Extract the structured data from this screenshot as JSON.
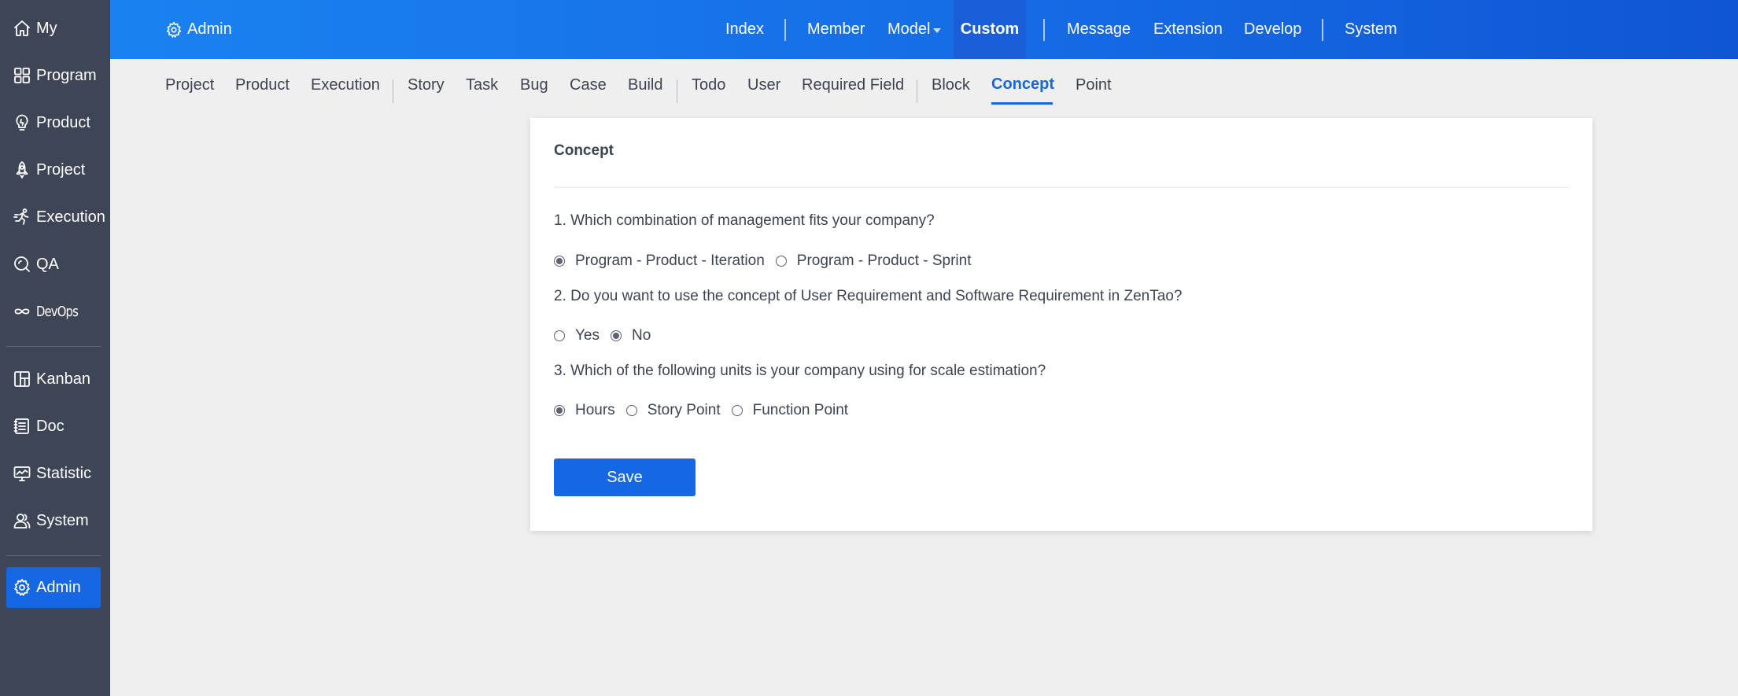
{
  "sidebar": {
    "items": [
      {
        "label": "My",
        "icon": "home-icon"
      },
      {
        "label": "Program",
        "icon": "grid-icon"
      },
      {
        "label": "Product",
        "icon": "lightbulb-icon"
      },
      {
        "label": "Project",
        "icon": "rocket-icon"
      },
      {
        "label": "Execution",
        "icon": "running-icon"
      },
      {
        "label": "QA",
        "icon": "magnifier-icon"
      },
      {
        "label": "DevOps",
        "icon": "infinity-icon"
      },
      {
        "label": "Kanban",
        "icon": "board-icon"
      },
      {
        "label": "Doc",
        "icon": "document-icon"
      },
      {
        "label": "Statistic",
        "icon": "monitor-chart-icon"
      },
      {
        "label": "System",
        "icon": "users-icon"
      },
      {
        "label": "Admin",
        "icon": "gear-icon"
      }
    ],
    "active": "Admin"
  },
  "header": {
    "brand": "Admin",
    "nav": [
      "Index",
      "Member",
      "Model",
      "Custom",
      "Message",
      "Extension",
      "Develop",
      "System"
    ],
    "active": "Custom"
  },
  "subnav": {
    "items": [
      "Project",
      "Product",
      "Execution",
      "Story",
      "Task",
      "Bug",
      "Case",
      "Build",
      "Todo",
      "User",
      "Required Field",
      "Block",
      "Concept",
      "Point"
    ],
    "active": "Concept"
  },
  "panel": {
    "title": "Concept",
    "questions": [
      {
        "text": "1. Which combination of management fits your company?",
        "options": [
          "Program - Product - Iteration",
          "Program - Product - Sprint"
        ],
        "selected": 0
      },
      {
        "text": "2. Do you want to use the concept of User Requirement and Software Requirement in ZenTao?",
        "options": [
          "Yes",
          "No"
        ],
        "selected": 1
      },
      {
        "text": "3. Which of the following units is your company using for scale estimation?",
        "options": [
          "Hours",
          "Story Point",
          "Function Point"
        ],
        "selected": 0
      }
    ],
    "save_label": "Save"
  },
  "colors": {
    "sidebar_bg": "#3e4556",
    "accent": "#1667e3",
    "header_gradient_start": "#1a82f0",
    "header_gradient_end": "#0f55d4",
    "page_bg": "#efefef"
  }
}
